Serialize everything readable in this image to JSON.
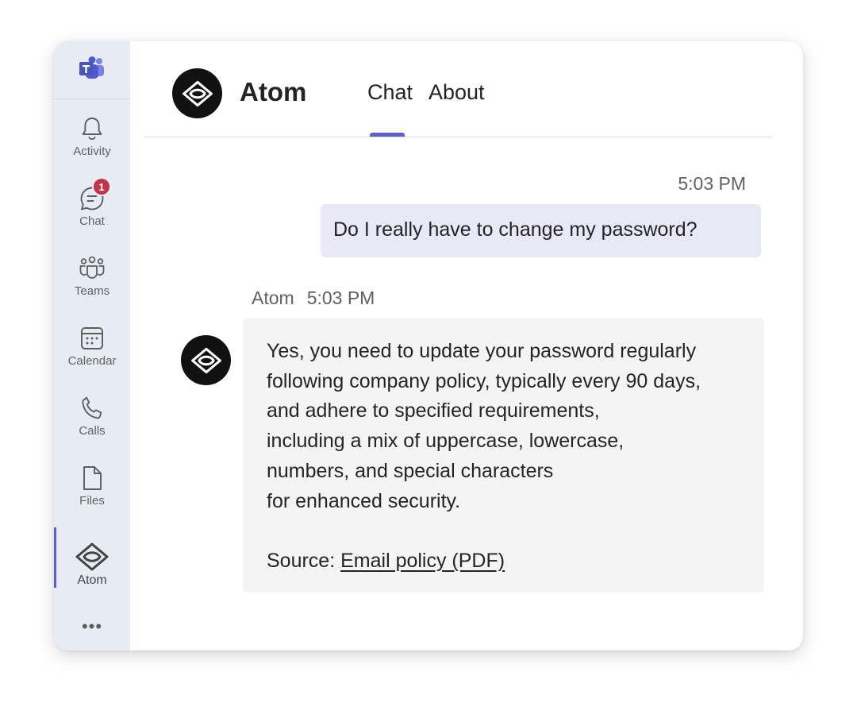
{
  "nav": {
    "items": [
      {
        "id": "activity",
        "label": "Activity",
        "icon": "bell-icon"
      },
      {
        "id": "chat",
        "label": "Chat",
        "icon": "chat-icon",
        "badge": "1"
      },
      {
        "id": "teams",
        "label": "Teams",
        "icon": "teams-icon"
      },
      {
        "id": "calendar",
        "label": "Calendar",
        "icon": "calendar-icon"
      },
      {
        "id": "calls",
        "label": "Calls",
        "icon": "phone-icon"
      },
      {
        "id": "files",
        "label": "Files",
        "icon": "file-icon"
      },
      {
        "id": "atom",
        "label": "Atom",
        "icon": "atom-logo-icon"
      }
    ],
    "active": "atom",
    "more": "•••"
  },
  "header": {
    "bot_name": "Atom",
    "tabs": [
      {
        "label": "Chat",
        "active": true
      },
      {
        "label": "About",
        "active": false
      }
    ]
  },
  "messages": {
    "user": {
      "time": "5:03 PM",
      "text": "Do I really have to change my password?"
    },
    "bot": {
      "sender": "Atom",
      "time": "5:03 PM",
      "lines": [
        "Yes, you need to update your password regularly",
        "following company policy, typically every 90 days,",
        "and adhere to specified requirements,",
        "including a mix of uppercase, lowercase,",
        "numbers, and special characters",
        "for enhanced security."
      ],
      "source_label": "Source: ",
      "source_link": "Email policy (PDF)"
    }
  },
  "colors": {
    "accent": "#5b5fc7",
    "rail_bg": "#e7ebf3",
    "badge": "#c4314b",
    "user_bubble": "#e8e8f7",
    "bot_bubble": "#f4f4f4"
  }
}
